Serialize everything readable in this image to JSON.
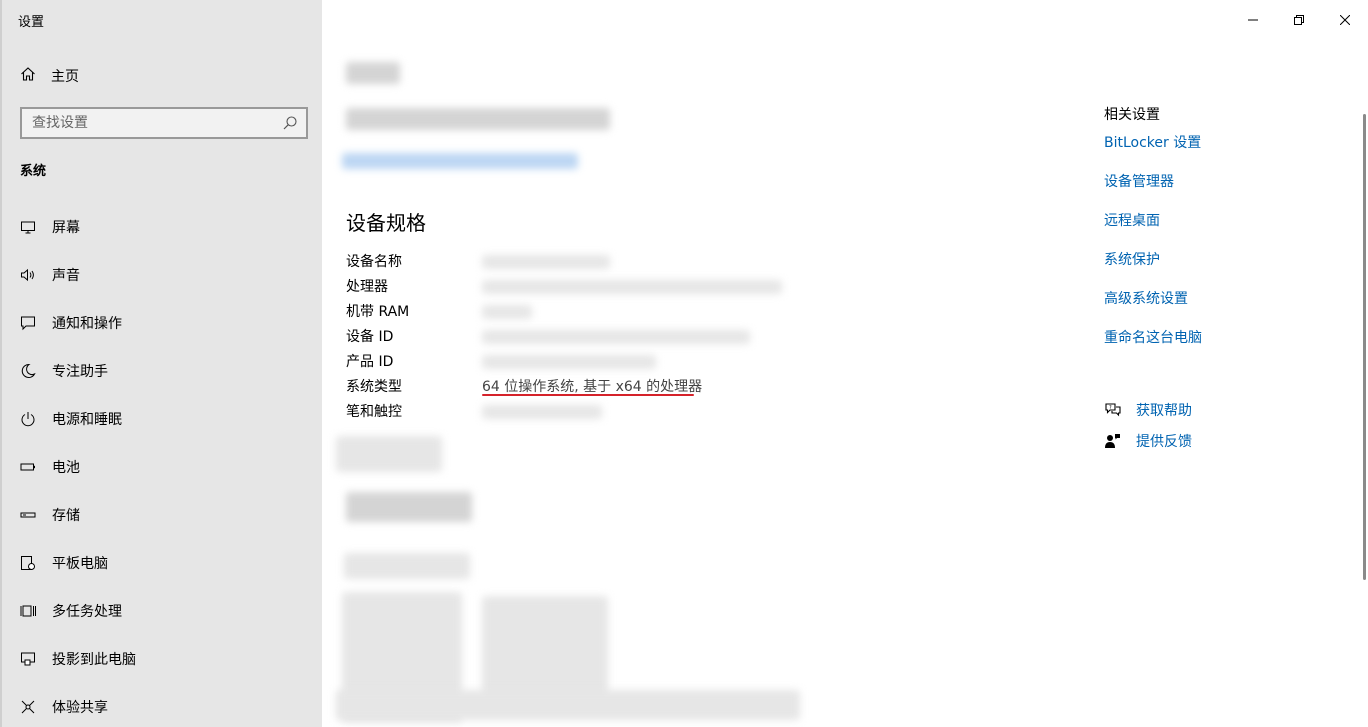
{
  "app": {
    "title": "设置"
  },
  "sidebar": {
    "home_label": "主页",
    "search_placeholder": "查找设置",
    "section_header": "系统",
    "items": [
      {
        "label": "屏幕",
        "icon": "monitor-icon"
      },
      {
        "label": "声音",
        "icon": "speaker-icon"
      },
      {
        "label": "通知和操作",
        "icon": "notification-icon"
      },
      {
        "label": "专注助手",
        "icon": "moon-icon"
      },
      {
        "label": "电源和睡眠",
        "icon": "power-icon"
      },
      {
        "label": "电池",
        "icon": "battery-icon"
      },
      {
        "label": "存储",
        "icon": "storage-icon"
      },
      {
        "label": "平板电脑",
        "icon": "tablet-icon"
      },
      {
        "label": "多任务处理",
        "icon": "multitask-icon"
      },
      {
        "label": "投影到此电脑",
        "icon": "project-icon"
      },
      {
        "label": "体验共享",
        "icon": "share-icon"
      }
    ]
  },
  "main": {
    "spec_heading": "设备规格",
    "specs": [
      {
        "label": "设备名称",
        "value": ""
      },
      {
        "label": "处理器",
        "value": ""
      },
      {
        "label": "机带 RAM",
        "value": ""
      },
      {
        "label": "设备 ID",
        "value": ""
      },
      {
        "label": "产品 ID",
        "value": ""
      },
      {
        "label": "系统类型",
        "value": "64 位操作系统, 基于 x64 的处理器"
      },
      {
        "label": "笔和触控",
        "value": ""
      }
    ]
  },
  "related": {
    "title": "相关设置",
    "links": [
      "BitLocker 设置",
      "设备管理器",
      "远程桌面",
      "系统保护",
      "高级系统设置",
      "重命名这台电脑"
    ]
  },
  "help": {
    "get_help": "获取帮助",
    "feedback": "提供反馈"
  },
  "colors": {
    "link": "#0063b1",
    "sidebar_bg": "#e6e6e6",
    "underline": "#d5222a"
  }
}
